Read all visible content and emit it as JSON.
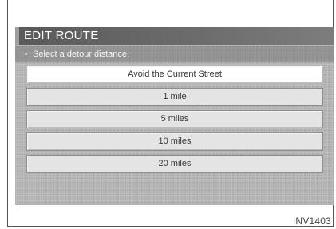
{
  "header": {
    "title": "EDIT ROUTE"
  },
  "instruction": {
    "bullet": "•",
    "text": "Select a detour distance."
  },
  "options": [
    {
      "label": "Avoid the Current Street",
      "selected": true
    },
    {
      "label": "1 mile",
      "selected": false
    },
    {
      "label": "5 miles",
      "selected": false
    },
    {
      "label": "10 miles",
      "selected": false
    },
    {
      "label": "20 miles",
      "selected": false
    }
  ],
  "caption": "INV1403",
  "colors": {
    "screen_background": "#b3b3b3",
    "title_bar": "#5a5a5a",
    "option_background": "#e4e4e4",
    "selected_option_background": "#ffffff"
  }
}
